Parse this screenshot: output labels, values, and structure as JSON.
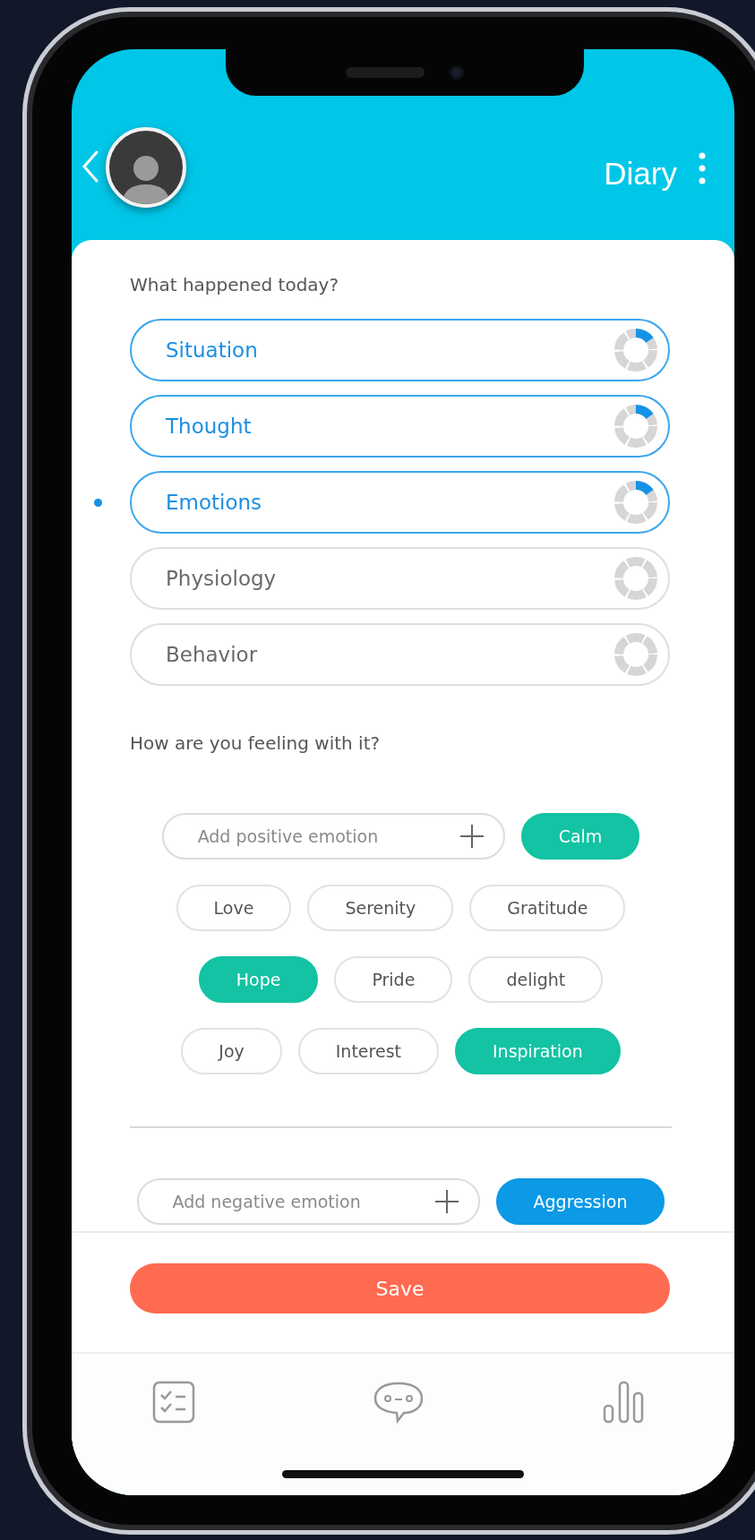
{
  "header": {
    "title": "Diary"
  },
  "question": "What happened today?",
  "steps": [
    {
      "label": "Situation",
      "active": true,
      "selected": false,
      "level": 0.15
    },
    {
      "label": "Thought",
      "active": true,
      "selected": false,
      "level": 0.15
    },
    {
      "label": "Emotions",
      "active": true,
      "selected": true,
      "level": 0.15
    },
    {
      "label": "Physiology",
      "active": false,
      "selected": false,
      "level": 0
    },
    {
      "label": "Behavior",
      "active": false,
      "selected": false,
      "level": 0
    }
  ],
  "feeling_question": "How are you feeling with it?",
  "sections": [
    {
      "kind": "positive",
      "placeholder": "Add positive emotion",
      "chip_rows": [
        [
          {
            "label": "Calm",
            "selected": true
          }
        ],
        [
          {
            "label": "Love",
            "selected": false
          },
          {
            "label": "Serenity",
            "selected": false
          },
          {
            "label": "Gratitude",
            "selected": false
          }
        ],
        [
          {
            "label": "Hope",
            "selected": true
          },
          {
            "label": "Pride",
            "selected": false
          },
          {
            "label": "delight",
            "selected": false
          }
        ],
        [
          {
            "label": "Joy",
            "selected": false
          },
          {
            "label": "Interest",
            "selected": false
          },
          {
            "label": "Inspiration",
            "selected": true
          }
        ]
      ]
    },
    {
      "kind": "negative",
      "placeholder": "Add negative emotion",
      "chip_rows": [
        [
          {
            "label": "Aggression",
            "selected": true
          }
        ]
      ]
    }
  ],
  "save_button": "Save"
}
